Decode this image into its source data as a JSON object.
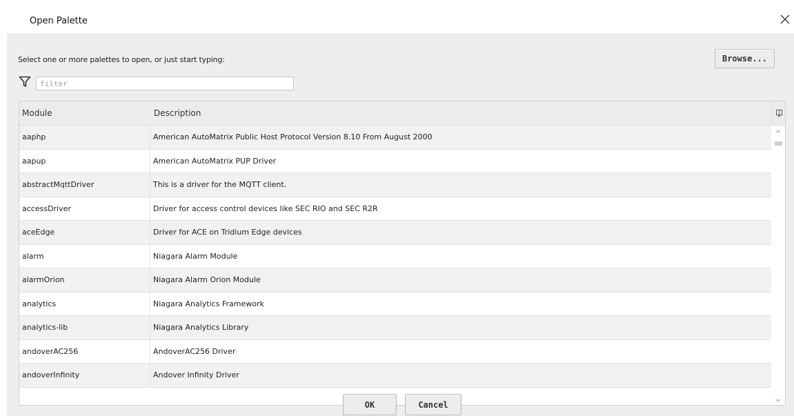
{
  "dialog": {
    "title": "Open Palette"
  },
  "prompt": "Select one or more palettes to open, or just start typing:",
  "browse_label": "Browse...",
  "filter": {
    "placeholder": "filter",
    "value": ""
  },
  "table": {
    "columns": [
      "Module",
      "Description"
    ],
    "rows": [
      {
        "module": "aaphp",
        "description": "American AutoMatrix Public Host Protocol Version 8.10 From August 2000"
      },
      {
        "module": "aapup",
        "description": "American AutoMatrix PUP Driver"
      },
      {
        "module": "abstractMqttDriver",
        "description": "This is a driver for the MQTT client."
      },
      {
        "module": "accessDriver",
        "description": "Driver for access control devices like SEC RIO and SEC R2R"
      },
      {
        "module": "aceEdge",
        "description": "Driver for ACE on Tridium Edge devices"
      },
      {
        "module": "alarm",
        "description": "Niagara Alarm Module"
      },
      {
        "module": "alarmOrion",
        "description": "Niagara Alarm Orion Module"
      },
      {
        "module": "analytics",
        "description": "Niagara Analytics Framework"
      },
      {
        "module": "analytics-lib",
        "description": "Niagara Analytics Library"
      },
      {
        "module": "andoverAC256",
        "description": "AndoverAC256 Driver"
      },
      {
        "module": "andoverInfinity",
        "description": "Andover Infinity Driver"
      }
    ]
  },
  "buttons": {
    "ok": "OK",
    "cancel": "Cancel"
  },
  "icons": {
    "close": "close-icon",
    "filter": "filter-icon",
    "column_chooser": "column-chooser-icon"
  }
}
